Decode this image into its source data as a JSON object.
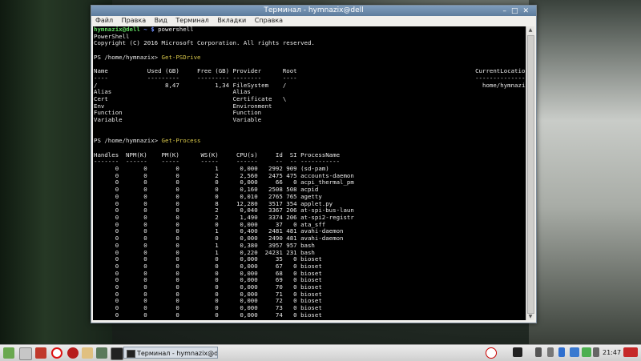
{
  "window": {
    "title": "Терминал - hymnazix@dell",
    "menu": [
      "Файл",
      "Правка",
      "Вид",
      "Терминал",
      "Вкладки",
      "Справка"
    ]
  },
  "terminal": {
    "user_host": "hymnazix@dell",
    "prompt_path": " ~ $ ",
    "command1": "powershell",
    "banner1": "PowerShell",
    "banner2": "Copyright (C) 2016 Microsoft Corporation. All rights reserved.",
    "ps_prompt": "PS /home/hymnazix> ",
    "cmd_drive": "Get-PSDrive",
    "drive_header": "Name           Used (GB)     Free (GB) Provider      Root                                                  CurrentLocation",
    "drive_sep": "----           ---------     --------- --------      ----                                                  ---------------",
    "drive_rows": [
      "/                   8,47          1,34 FileSystem    /                                                       home/hymnazix",
      "Alias                                  Alias",
      "Cert                                   Certificate   \\",
      "Env                                    Environment",
      "Function                               Function",
      "Variable                               Variable"
    ],
    "cmd_process": "Get-Process",
    "proc_header": "Handles  NPM(K)    PM(K)      WS(K)     CPU(s)     Id  SI ProcessName",
    "proc_sep": "-------  ------    -----      -----     ------     --  -- -----------",
    "proc_rows": [
      "      0       0        0          1      0,000   2992 909 (sd-pam)",
      "      0       0        0          2      2,560   2475 475 accounts-daemon",
      "      0       0        0          0      0,000     66   0 acpi_thermal_pm",
      "      0       0        0          0      0,160   2508 508 acpid",
      "      0       0        0          0      0,010   2765 765 agetty",
      "      0       0        0          8     12,280   3517 354 applet.py",
      "      0       0        0          2      0,040   3367 206 at-spi-bus-laun",
      "      0       0        0          2      1,490   3374 206 at-spi2-registr",
      "      0       0        0          0      0,000     37   0 ata_sff",
      "      0       0        0          1      0,400   2481 481 avahi-daemon",
      "      0       0        0          0      0,000   2490 481 avahi-daemon",
      "      0       0        0          1      0,380   3957 957 bash",
      "      0       0        0          1      0,220  24231 231 bash",
      "      0       0        0          0      0,000     35   0 bioset",
      "      0       0        0          0      0,000     67   0 bioset",
      "      0       0        0          0      0,000     68   0 bioset",
      "      0       0        0          0      0,000     69   0 bioset",
      "      0       0        0          0      0,000     70   0 bioset",
      "      0       0        0          0      0,000     71   0 bioset",
      "      0       0        0          0      0,000     72   0 bioset",
      "      0       0        0          0      0,000     73   0 bioset",
      "      0       0        0          0      0,000     74   0 bioset"
    ]
  },
  "taskbar": {
    "task_label": "Терминал - hymnazix@dell",
    "clock": "21:47"
  },
  "colors": {
    "prompt_green": "#5fd75f",
    "prompt_blue": "#6f8fff",
    "command_yellow": "#d7c64a"
  }
}
